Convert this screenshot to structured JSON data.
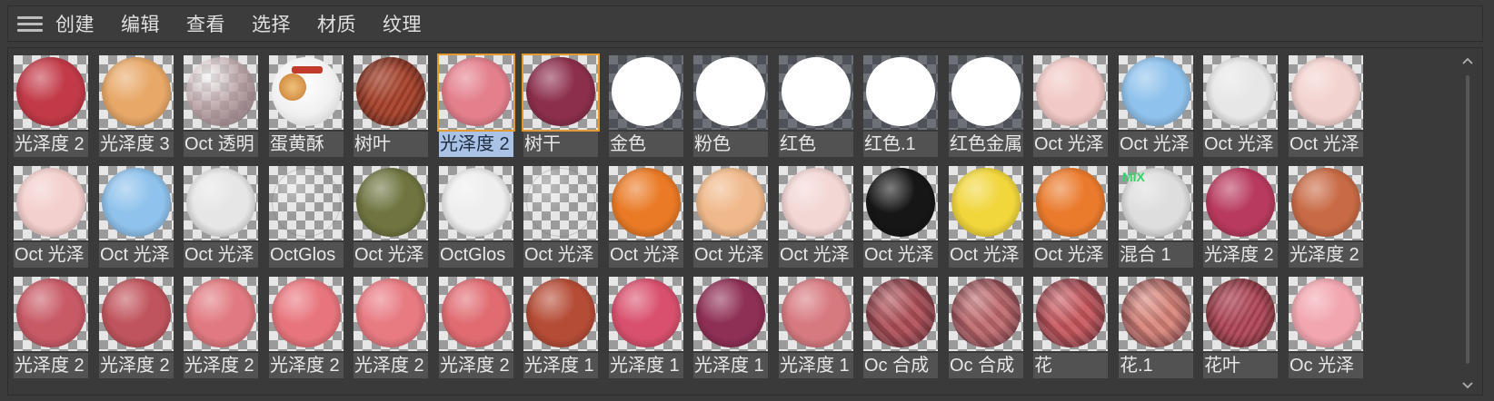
{
  "menu": [
    "创建",
    "编辑",
    "查看",
    "选择",
    "材质",
    "纹理"
  ],
  "rows": [
    [
      {
        "label": "光泽度 2",
        "color": "#c23a48",
        "tex": "plain"
      },
      {
        "label": "光泽度 3",
        "color": "#e8a868",
        "tex": "plain"
      },
      {
        "label": "Oct 透明",
        "color": "#b89ea2",
        "tex": "glass"
      },
      {
        "label": "蛋黄酥",
        "color": "#f2f2f2",
        "tex": "decal"
      },
      {
        "label": "树叶",
        "color": "#a8432c",
        "tex": "leaf"
      },
      {
        "label": "光泽度 2",
        "color": "#e47f8c",
        "tex": "plain",
        "selected": true,
        "active": true
      },
      {
        "label": "树干",
        "color": "#8c2f4d",
        "tex": "plain",
        "selected": true
      },
      {
        "label": "金色",
        "color": "#ffffff",
        "tex": "white",
        "dark": true
      },
      {
        "label": "粉色",
        "color": "#ffffff",
        "tex": "white",
        "dark": true
      },
      {
        "label": "红色",
        "color": "#ffffff",
        "tex": "white",
        "dark": true
      },
      {
        "label": "红色.1",
        "color": "#ffffff",
        "tex": "white",
        "dark": true
      },
      {
        "label": "红色金属",
        "color": "#ffffff",
        "tex": "white",
        "dark": true
      },
      {
        "label": "Oct 光泽",
        "color": "#f1c9c6",
        "tex": "plain"
      },
      {
        "label": "Oct 光泽",
        "color": "#8fc2ec",
        "tex": "plain"
      },
      {
        "label": "Oct 光泽",
        "color": "#e7e7e7",
        "tex": "plain"
      },
      {
        "label": "Oct 光泽",
        "color": "#f3d3d0",
        "tex": "plain"
      }
    ],
    [
      {
        "label": "Oct 光泽",
        "color": "#f3cfcd",
        "tex": "plain"
      },
      {
        "label": "Oct 光泽",
        "color": "#8fc2ec",
        "tex": "plain"
      },
      {
        "label": "Oct 光泽",
        "color": "#e6e6e6",
        "tex": "plain"
      },
      {
        "label": "OctGlos",
        "color": "none",
        "tex": "clear"
      },
      {
        "label": "Oct 光泽",
        "color": "#6f7440",
        "tex": "plain"
      },
      {
        "label": "OctGlos",
        "color": "#eeeeee",
        "tex": "plain"
      },
      {
        "label": "Oct 光泽",
        "color": "none",
        "tex": "clear"
      },
      {
        "label": "Oct 光泽",
        "color": "#ea7a26",
        "tex": "plain"
      },
      {
        "label": "Oct 光泽",
        "color": "#f0b98b",
        "tex": "plain"
      },
      {
        "label": "Oct 光泽",
        "color": "#f3d7d5",
        "tex": "plain"
      },
      {
        "label": "Oct 光泽",
        "color": "#161616",
        "tex": "plain"
      },
      {
        "label": "Oct 光泽",
        "color": "#f1d63c",
        "tex": "plain"
      },
      {
        "label": "Oct 光泽",
        "color": "#ea7a2c",
        "tex": "plain"
      },
      {
        "label": "混合 1",
        "color": "#dedede",
        "tex": "plain",
        "mix": "MIX"
      },
      {
        "label": "光泽度 2",
        "color": "#b83a5e",
        "tex": "plain"
      },
      {
        "label": "光泽度 2",
        "color": "#c86a45",
        "tex": "plain"
      }
    ],
    [
      {
        "label": "光泽度 2",
        "color": "#c85a66",
        "tex": "plain"
      },
      {
        "label": "光泽度 2",
        "color": "#c0545c",
        "tex": "plain"
      },
      {
        "label": "光泽度 2",
        "color": "#e07a80",
        "tex": "plain"
      },
      {
        "label": "光泽度 2",
        "color": "#e8757d",
        "tex": "plain"
      },
      {
        "label": "光泽度 2",
        "color": "#e87a82",
        "tex": "plain"
      },
      {
        "label": "光泽度 2",
        "color": "#e06c72",
        "tex": "plain"
      },
      {
        "label": "光泽度 1",
        "color": "#b54c36",
        "tex": "plain"
      },
      {
        "label": "光泽度 1",
        "color": "#d9506e",
        "tex": "plain"
      },
      {
        "label": "光泽度 1",
        "color": "#8e2f55",
        "tex": "plain"
      },
      {
        "label": "光泽度 1",
        "color": "#d77a80",
        "tex": "plain"
      },
      {
        "label": "Oc 合成",
        "color": "#b05058",
        "tex": "check"
      },
      {
        "label": "Oc 合成",
        "color": "#c06a6e",
        "tex": "check"
      },
      {
        "label": "花",
        "color": "#c8585e",
        "tex": "check"
      },
      {
        "label": "花.1",
        "color": "#d8847a",
        "tex": "check"
      },
      {
        "label": "花叶",
        "color": "#b0485a",
        "tex": "leaf"
      },
      {
        "label": "Oc 光泽",
        "color": "#f2a6b0",
        "tex": "plain"
      }
    ]
  ]
}
